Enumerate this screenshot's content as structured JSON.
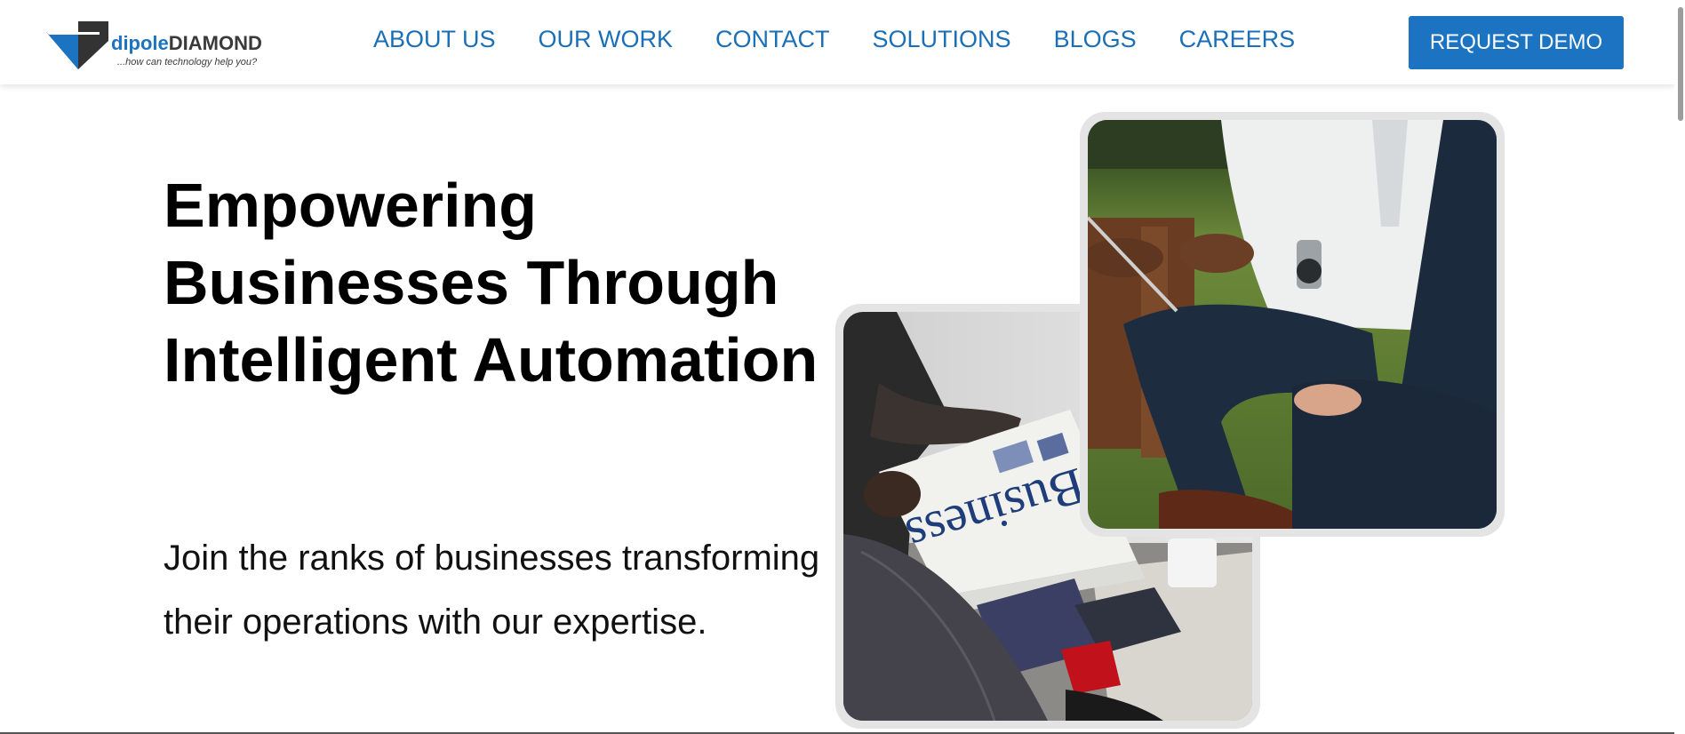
{
  "brand": {
    "name_part1": "dipole",
    "name_part2": "DIAMOND",
    "tagline": "...how can technology help you?",
    "colors": {
      "primary": "#1b73c1",
      "dark": "#3a3a3a"
    }
  },
  "nav": {
    "items": [
      {
        "label": "ABOUT US"
      },
      {
        "label": "OUR WORK"
      },
      {
        "label": "CONTACT"
      },
      {
        "label": "SOLUTIONS"
      },
      {
        "label": "BLOGS"
      },
      {
        "label": "CAREERS"
      }
    ],
    "cta_label": "REQUEST DEMO"
  },
  "hero": {
    "title": "Empowering Businesses Through Intelligent Automation",
    "subtitle": "Join the ranks of businesses transforming their operations with our expertise.",
    "images": {
      "back": {
        "subject": "hands-holding-newspaper-photo",
        "newspaper_word": "Business"
      },
      "front": {
        "subject": "business-meeting-outdoors-photo"
      }
    }
  }
}
